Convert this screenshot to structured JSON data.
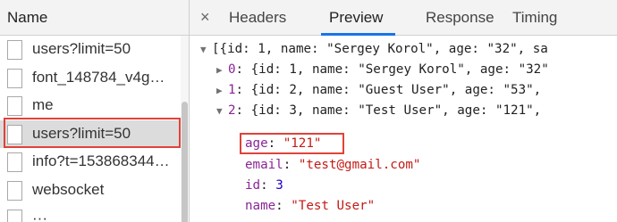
{
  "request_list": {
    "header": "Name",
    "items": [
      {
        "label": "users?limit=50",
        "selected": false
      },
      {
        "label": "font_148784_v4g…",
        "selected": false
      },
      {
        "label": "me",
        "selected": false
      },
      {
        "label": "users?limit=50",
        "selected": true
      },
      {
        "label": "info?t=153868344…",
        "selected": false
      },
      {
        "label": "websocket",
        "selected": false
      },
      {
        "label": "···",
        "selected": false
      }
    ]
  },
  "tabs": {
    "close_symbol": "×",
    "items": [
      "Headers",
      "Preview",
      "Response",
      "Timing"
    ],
    "active": "Preview"
  },
  "preview": {
    "line0": {
      "triangle": "▼",
      "text": "[{id: 1, name: \"Sergey Korol\", age: \"32\", sa"
    },
    "line1": {
      "triangle": "▶",
      "index": "0",
      "text": ": {id: 1, name: \"Sergey Korol\", age: \"32\""
    },
    "line2": {
      "triangle": "▶",
      "index": "1",
      "text": ": {id: 2, name: \"Guest User\", age: \"53\","
    },
    "line3": {
      "triangle": "▼",
      "index": "2",
      "text": ": {id: 3, name: \"Test User\", age: \"121\","
    },
    "props": [
      {
        "key": "age",
        "value": "\"121\"",
        "type": "string"
      },
      {
        "key": "email",
        "value": "\"test@gmail.com\"",
        "type": "string"
      },
      {
        "key": "id",
        "value": "3",
        "type": "number"
      },
      {
        "key": "name",
        "value": "\"Test User\"",
        "type": "string"
      }
    ]
  },
  "colors": {
    "highlight_outline": "#e0423a",
    "active_tab_underline": "#1a73e8",
    "string_value": "#c41a16",
    "key_color": "#8a2596",
    "number_value": "#1c00cf"
  }
}
